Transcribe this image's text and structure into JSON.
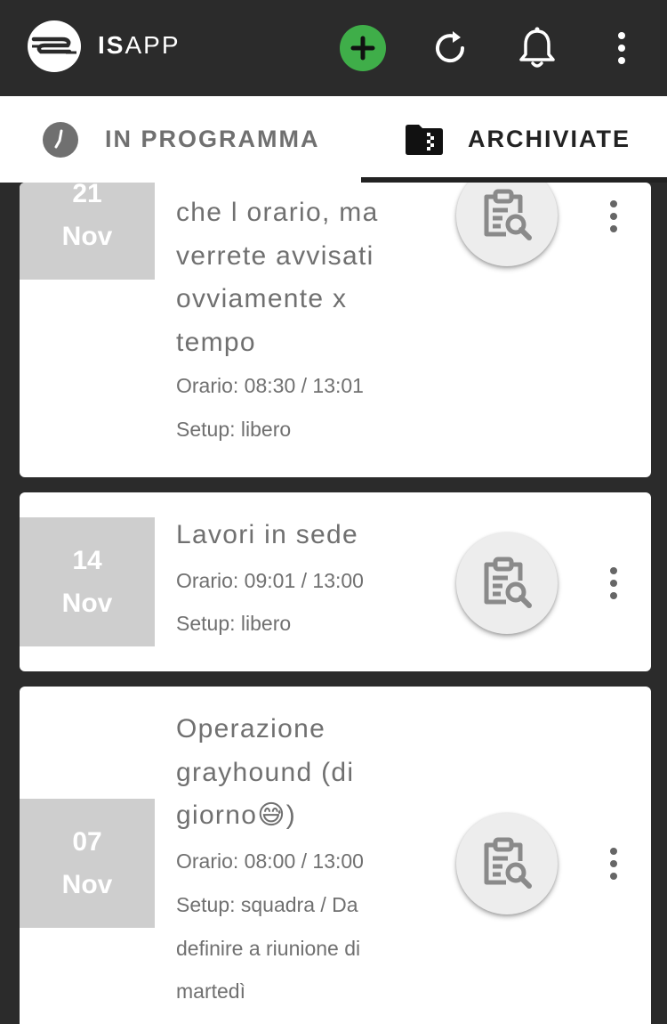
{
  "header": {
    "brand_bold": "IS",
    "brand_light": "APP",
    "icons": [
      "logo",
      "add-icon",
      "refresh-icon",
      "bell-icon",
      "more-vert-icon"
    ],
    "colors": {
      "bar": "#2b2b2b",
      "add": "#3fae49"
    }
  },
  "tabs": [
    {
      "label": "IN PROGRAMMA",
      "icon": "clock-icon",
      "active": false
    },
    {
      "label": "ARCHIVIATE",
      "icon": "archive-folder-icon",
      "active": true
    }
  ],
  "events": [
    {
      "day": "21",
      "month": "Nov",
      "title_lines": [
        "che l orario, ma",
        "verrete avvisati",
        "ovviamente x",
        "tempo"
      ],
      "time": "Orario: 08:30 / 13:01",
      "setup": "Setup: libero"
    },
    {
      "day": "14",
      "month": "Nov",
      "title_lines": [
        "Lavori in sede"
      ],
      "time": "Orario: 09:01 / 13:00",
      "setup": "Setup: libero"
    },
    {
      "day": "07",
      "month": "Nov",
      "title_lines": [
        "Operazione",
        "grayhound (di",
        "giorno😅)"
      ],
      "time": "Orario: 08:00 / 13:00",
      "setup_lines": [
        "Setup: squadra / Da",
        "definire a riunione di",
        "martedì"
      ]
    }
  ]
}
